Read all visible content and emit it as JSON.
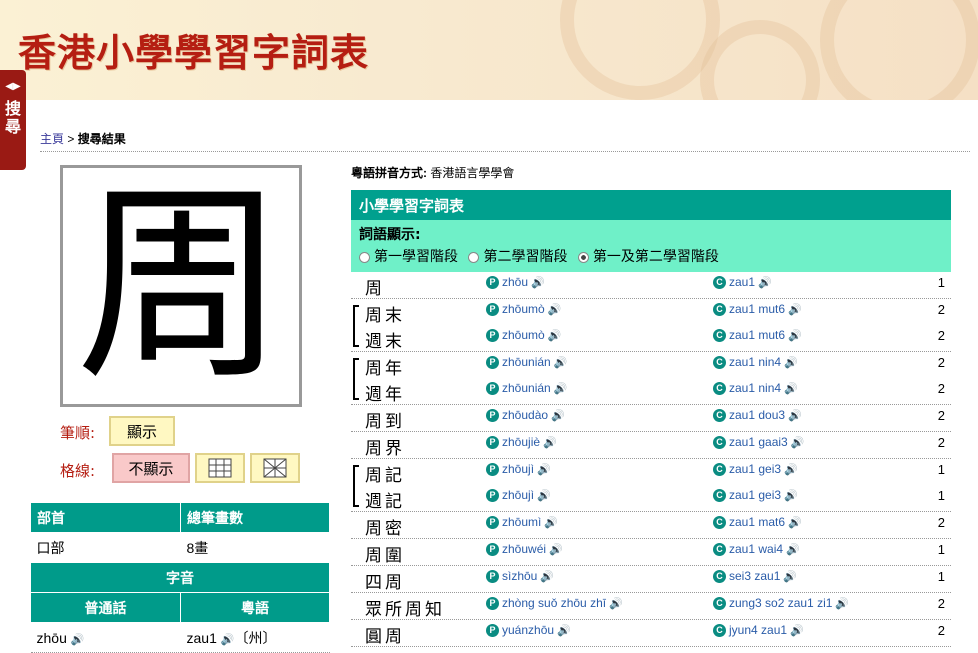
{
  "site_title": "香港小學學習字詞表",
  "side_tab": "搜尋",
  "breadcrumb": {
    "home": "主頁",
    "sep": " > ",
    "current": "搜尋結果"
  },
  "character": "周",
  "stroke_order": {
    "label": "筆順:",
    "show": "顯示"
  },
  "grid": {
    "label": "格線:",
    "hide": "不顯示"
  },
  "info": {
    "radical_h": "部首",
    "strokes_h": "總筆畫數",
    "radical": "口部",
    "strokes": "8畫",
    "pron_h": "字音",
    "mandarin_h": "普通話",
    "cantonese_h": "粵語",
    "mandarin": "zhōu",
    "cantonese": "zau1",
    "cantonese_note": "〔州〕"
  },
  "note_label": "粵語拼音方式:",
  "note_value": "香港語言學學會",
  "table_title": "小學學習字詞表",
  "filter_label": "詞語顯示:",
  "filter_opts": [
    "第一學習階段",
    "第二學習階段",
    "第一及第二學習階段"
  ],
  "words": [
    {
      "w": "周",
      "py": "zhōu",
      "jp": "zau1",
      "n": "1"
    },
    {
      "w": "周末",
      "py": "zhōumò",
      "jp": "zau1 mut6",
      "n": "2"
    },
    {
      "w": "週末",
      "py": "zhōumò",
      "jp": "zau1 mut6",
      "n": "2"
    },
    {
      "w": "周年",
      "py": "zhōunián",
      "jp": "zau1 nin4",
      "n": "2"
    },
    {
      "w": "週年",
      "py": "zhōunián",
      "jp": "zau1 nin4",
      "n": "2"
    },
    {
      "w": "周到",
      "py": "zhōudào",
      "jp": "zau1 dou3",
      "n": "2"
    },
    {
      "w": "周界",
      "py": "zhōujiè",
      "jp": "zau1 gaai3",
      "n": "2"
    },
    {
      "w": "周記",
      "py": "zhōujì",
      "jp": "zau1 gei3",
      "n": "1"
    },
    {
      "w": "週記",
      "py": "zhōujì",
      "jp": "zau1 gei3",
      "n": "1"
    },
    {
      "w": "周密",
      "py": "zhōumì",
      "jp": "zau1 mat6",
      "n": "2"
    },
    {
      "w": "周圍",
      "py": "zhōuwéi",
      "jp": "zau1 wai4",
      "n": "1"
    },
    {
      "w": "四周",
      "py": "sìzhōu",
      "jp": "sei3 zau1",
      "n": "1"
    },
    {
      "w": "眾所周知",
      "py": "zhòng suǒ zhōu zhī",
      "jp": "zung3 so2 zau1 zi1",
      "n": "2"
    },
    {
      "w": "圓周",
      "py": "yuánzhōu",
      "jp": "jyun4 zau1",
      "n": "2"
    }
  ]
}
